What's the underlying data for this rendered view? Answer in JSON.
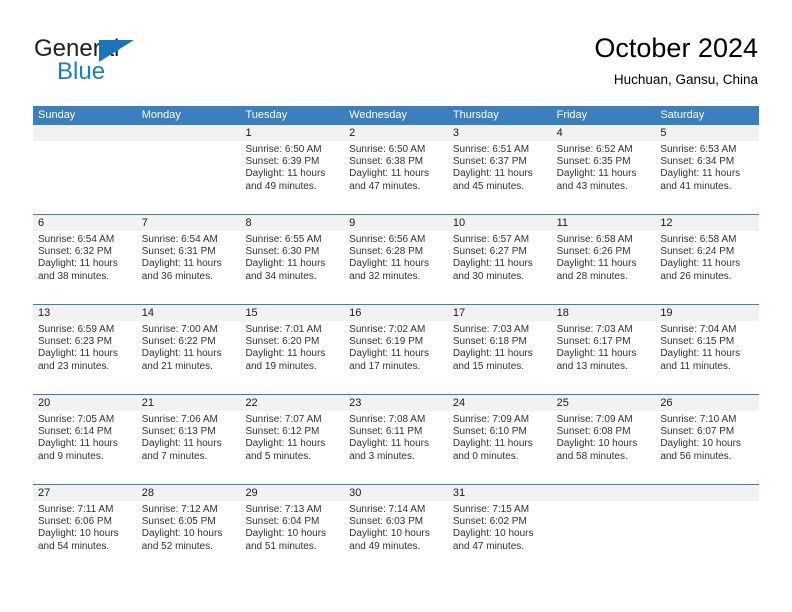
{
  "brand": {
    "word_one": "General",
    "word_two": "Blue",
    "triangle_icon": "triangle-icon",
    "accent_color": "#1b75bb"
  },
  "header": {
    "title": "October 2024",
    "subtitle": "Huchuan, Gansu, China"
  },
  "calendar": {
    "header_color": "#3b7fbe",
    "daynum_band_color": "#f2f2f2",
    "weekdays": [
      "Sunday",
      "Monday",
      "Tuesday",
      "Wednesday",
      "Thursday",
      "Friday",
      "Saturday"
    ],
    "weeks": [
      [
        {
          "day": "",
          "lines": []
        },
        {
          "day": "",
          "lines": []
        },
        {
          "day": "1",
          "lines": [
            "Sunrise: 6:50 AM",
            "Sunset: 6:39 PM",
            "Daylight: 11 hours",
            "and 49 minutes."
          ]
        },
        {
          "day": "2",
          "lines": [
            "Sunrise: 6:50 AM",
            "Sunset: 6:38 PM",
            "Daylight: 11 hours",
            "and 47 minutes."
          ]
        },
        {
          "day": "3",
          "lines": [
            "Sunrise: 6:51 AM",
            "Sunset: 6:37 PM",
            "Daylight: 11 hours",
            "and 45 minutes."
          ]
        },
        {
          "day": "4",
          "lines": [
            "Sunrise: 6:52 AM",
            "Sunset: 6:35 PM",
            "Daylight: 11 hours",
            "and 43 minutes."
          ]
        },
        {
          "day": "5",
          "lines": [
            "Sunrise: 6:53 AM",
            "Sunset: 6:34 PM",
            "Daylight: 11 hours",
            "and 41 minutes."
          ]
        }
      ],
      [
        {
          "day": "6",
          "lines": [
            "Sunrise: 6:54 AM",
            "Sunset: 6:32 PM",
            "Daylight: 11 hours",
            "and 38 minutes."
          ]
        },
        {
          "day": "7",
          "lines": [
            "Sunrise: 6:54 AM",
            "Sunset: 6:31 PM",
            "Daylight: 11 hours",
            "and 36 minutes."
          ]
        },
        {
          "day": "8",
          "lines": [
            "Sunrise: 6:55 AM",
            "Sunset: 6:30 PM",
            "Daylight: 11 hours",
            "and 34 minutes."
          ]
        },
        {
          "day": "9",
          "lines": [
            "Sunrise: 6:56 AM",
            "Sunset: 6:28 PM",
            "Daylight: 11 hours",
            "and 32 minutes."
          ]
        },
        {
          "day": "10",
          "lines": [
            "Sunrise: 6:57 AM",
            "Sunset: 6:27 PM",
            "Daylight: 11 hours",
            "and 30 minutes."
          ]
        },
        {
          "day": "11",
          "lines": [
            "Sunrise: 6:58 AM",
            "Sunset: 6:26 PM",
            "Daylight: 11 hours",
            "and 28 minutes."
          ]
        },
        {
          "day": "12",
          "lines": [
            "Sunrise: 6:58 AM",
            "Sunset: 6:24 PM",
            "Daylight: 11 hours",
            "and 26 minutes."
          ]
        }
      ],
      [
        {
          "day": "13",
          "lines": [
            "Sunrise: 6:59 AM",
            "Sunset: 6:23 PM",
            "Daylight: 11 hours",
            "and 23 minutes."
          ]
        },
        {
          "day": "14",
          "lines": [
            "Sunrise: 7:00 AM",
            "Sunset: 6:22 PM",
            "Daylight: 11 hours",
            "and 21 minutes."
          ]
        },
        {
          "day": "15",
          "lines": [
            "Sunrise: 7:01 AM",
            "Sunset: 6:20 PM",
            "Daylight: 11 hours",
            "and 19 minutes."
          ]
        },
        {
          "day": "16",
          "lines": [
            "Sunrise: 7:02 AM",
            "Sunset: 6:19 PM",
            "Daylight: 11 hours",
            "and 17 minutes."
          ]
        },
        {
          "day": "17",
          "lines": [
            "Sunrise: 7:03 AM",
            "Sunset: 6:18 PM",
            "Daylight: 11 hours",
            "and 15 minutes."
          ]
        },
        {
          "day": "18",
          "lines": [
            "Sunrise: 7:03 AM",
            "Sunset: 6:17 PM",
            "Daylight: 11 hours",
            "and 13 minutes."
          ]
        },
        {
          "day": "19",
          "lines": [
            "Sunrise: 7:04 AM",
            "Sunset: 6:15 PM",
            "Daylight: 11 hours",
            "and 11 minutes."
          ]
        }
      ],
      [
        {
          "day": "20",
          "lines": [
            "Sunrise: 7:05 AM",
            "Sunset: 6:14 PM",
            "Daylight: 11 hours",
            "and 9 minutes."
          ]
        },
        {
          "day": "21",
          "lines": [
            "Sunrise: 7:06 AM",
            "Sunset: 6:13 PM",
            "Daylight: 11 hours",
            "and 7 minutes."
          ]
        },
        {
          "day": "22",
          "lines": [
            "Sunrise: 7:07 AM",
            "Sunset: 6:12 PM",
            "Daylight: 11 hours",
            "and 5 minutes."
          ]
        },
        {
          "day": "23",
          "lines": [
            "Sunrise: 7:08 AM",
            "Sunset: 6:11 PM",
            "Daylight: 11 hours",
            "and 3 minutes."
          ]
        },
        {
          "day": "24",
          "lines": [
            "Sunrise: 7:09 AM",
            "Sunset: 6:10 PM",
            "Daylight: 11 hours",
            "and 0 minutes."
          ]
        },
        {
          "day": "25",
          "lines": [
            "Sunrise: 7:09 AM",
            "Sunset: 6:08 PM",
            "Daylight: 10 hours",
            "and 58 minutes."
          ]
        },
        {
          "day": "26",
          "lines": [
            "Sunrise: 7:10 AM",
            "Sunset: 6:07 PM",
            "Daylight: 10 hours",
            "and 56 minutes."
          ]
        }
      ],
      [
        {
          "day": "27",
          "lines": [
            "Sunrise: 7:11 AM",
            "Sunset: 6:06 PM",
            "Daylight: 10 hours",
            "and 54 minutes."
          ]
        },
        {
          "day": "28",
          "lines": [
            "Sunrise: 7:12 AM",
            "Sunset: 6:05 PM",
            "Daylight: 10 hours",
            "and 52 minutes."
          ]
        },
        {
          "day": "29",
          "lines": [
            "Sunrise: 7:13 AM",
            "Sunset: 6:04 PM",
            "Daylight: 10 hours",
            "and 51 minutes."
          ]
        },
        {
          "day": "30",
          "lines": [
            "Sunrise: 7:14 AM",
            "Sunset: 6:03 PM",
            "Daylight: 10 hours",
            "and 49 minutes."
          ]
        },
        {
          "day": "31",
          "lines": [
            "Sunrise: 7:15 AM",
            "Sunset: 6:02 PM",
            "Daylight: 10 hours",
            "and 47 minutes."
          ]
        },
        {
          "day": "",
          "lines": []
        },
        {
          "day": "",
          "lines": []
        }
      ]
    ]
  }
}
